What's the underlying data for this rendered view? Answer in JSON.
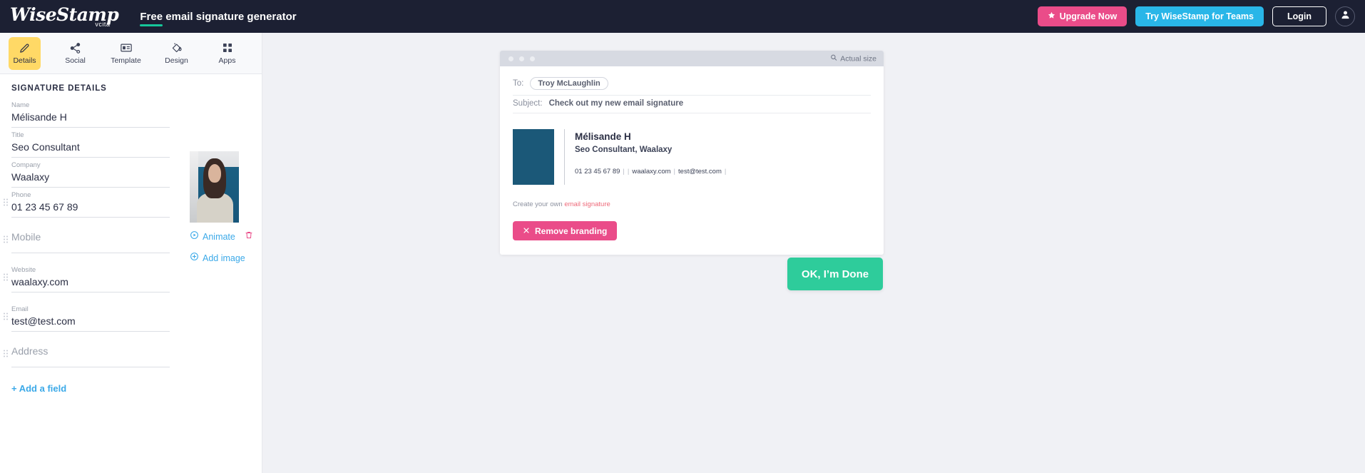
{
  "header": {
    "logo_text": "WiseStamp",
    "logo_sub": "vcita",
    "title_first_word": "Free",
    "title_rest": " email signature generator",
    "upgrade_label": "Upgrade Now",
    "teams_label": "Try WiseStamp for Teams",
    "login_label": "Login",
    "star_icon": "star-icon",
    "avatar_icon": "user-avatar-icon",
    "background": "#1c2033",
    "accent_pink": "#ea4c89",
    "accent_cyan": "#29b6e8",
    "accent_green": "#16c79a"
  },
  "tabs": [
    {
      "label": "Details",
      "icon": "pencil-icon",
      "active": true
    },
    {
      "label": "Social",
      "icon": "share-icon",
      "active": false
    },
    {
      "label": "Template",
      "icon": "template-card-icon",
      "active": false
    },
    {
      "label": "Design",
      "icon": "paint-bucket-icon",
      "active": false
    },
    {
      "label": "Apps",
      "icon": "grid-apps-icon",
      "active": false
    }
  ],
  "sidebar": {
    "panel_title": "SIGNATURE DETAILS",
    "fields": [
      {
        "label": "Name",
        "value": "Mélisande H",
        "placeholder": "Name",
        "draggable": false
      },
      {
        "label": "Title",
        "value": "Seo Consultant",
        "placeholder": "Title",
        "draggable": false
      },
      {
        "label": "Company",
        "value": "Waalaxy",
        "placeholder": "Company",
        "draggable": false
      },
      {
        "label": "Phone",
        "value": "01 23 45 67 89",
        "placeholder": "Phone",
        "draggable": true
      },
      {
        "label": "",
        "value": "",
        "placeholder": "Mobile",
        "draggable": true
      },
      {
        "label": "Website",
        "value": "waalaxy.com",
        "placeholder": "Website",
        "draggable": true
      },
      {
        "label": "Email",
        "value": "test@test.com",
        "placeholder": "Email",
        "draggable": true
      },
      {
        "label": "",
        "value": "",
        "placeholder": "Address",
        "draggable": true
      }
    ],
    "add_field_label": "+ Add a field",
    "photo": {
      "animate_label": "Animate",
      "animate_icon": "play-circle-icon",
      "delete_icon": "trash-icon",
      "add_image_label": "Add image",
      "add_image_icon": "plus-circle-icon",
      "alt": "profile-photo-woman-dark-hair-cream-sweater"
    }
  },
  "preview": {
    "window_dots": 3,
    "actual_size_label": "Actual size",
    "actual_size_icon": "magnifier-icon",
    "to_label": "To:",
    "recipient": "Troy McLaughlin",
    "subject_label": "Subject:",
    "subject_value": "Check out my new email signature",
    "signature": {
      "name": "Mélisande H",
      "title_line": "Seo Consultant, Waalaxy",
      "phone": "01 23 45 67 89",
      "website": "waalaxy.com",
      "email": "test@test.com",
      "separator": "|"
    },
    "branding": {
      "prefix": "Create your own ",
      "link_text": "email signature",
      "remove_label": "Remove branding",
      "remove_icon": "close-x-icon"
    }
  },
  "footer": {
    "done_label": "OK, I’m Done",
    "done_color": "#2ecc9b"
  }
}
